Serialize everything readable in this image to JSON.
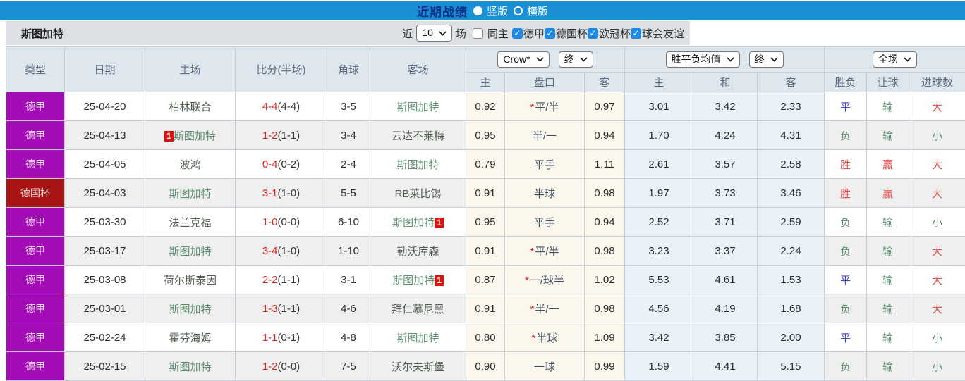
{
  "titlebar": {
    "title": "近期战绩",
    "options": [
      {
        "label": "竖版",
        "selected": true
      },
      {
        "label": "横版",
        "selected": false
      }
    ]
  },
  "toolbar": {
    "team": "斯图加特",
    "recent_label": "近",
    "recent_count": "10",
    "unit_label": "场",
    "same_home": {
      "label": "同主",
      "checked": false
    },
    "league_filters": [
      {
        "label": "德甲",
        "checked": true
      },
      {
        "label": "德国杯",
        "checked": true
      },
      {
        "label": "欧冠杯",
        "checked": true
      },
      {
        "label": "球会友谊",
        "checked": true
      }
    ]
  },
  "table": {
    "main_headers": [
      "类型",
      "日期",
      "主场",
      "比分(半场)",
      "角球",
      "客场"
    ],
    "selects": {
      "bookmaker": "Crow*",
      "bookmaker_period": "终",
      "avg": "胜平负均值",
      "avg_period": "终",
      "scope": "全场"
    },
    "sub_headers": [
      "主",
      "盘口",
      "客",
      "主",
      "和",
      "客",
      "胜负",
      "让球",
      "进球数"
    ],
    "rows": [
      {
        "type": "德甲",
        "type_cls": "purple",
        "date": "25-04-20",
        "home": {
          "name": "柏林联合",
          "hl": false,
          "badge": null,
          "badge_pos": null
        },
        "score": {
          "full": "4-4",
          "half": "(4-4)"
        },
        "corners": "3-5",
        "away": {
          "name": "斯图加特",
          "hl": true,
          "badge": null,
          "badge_pos": null
        },
        "odds": {
          "home": "0.92",
          "star": true,
          "handicap": "平/半",
          "away": "0.97"
        },
        "avg": [
          "3.01",
          "3.42",
          "2.33"
        ],
        "result": [
          {
            "t": "平",
            "c": "blue"
          },
          {
            "t": "输",
            "c": "green"
          },
          {
            "t": "大",
            "c": "red"
          }
        ]
      },
      {
        "type": "德甲",
        "type_cls": "purple",
        "date": "25-04-13",
        "home": {
          "name": "斯图加特",
          "hl": true,
          "badge": "1",
          "badge_pos": "before"
        },
        "score": {
          "full": "1-2",
          "half": "(1-1)"
        },
        "corners": "3-4",
        "away": {
          "name": "云达不莱梅",
          "hl": false,
          "badge": null,
          "badge_pos": null
        },
        "odds": {
          "home": "0.95",
          "star": false,
          "handicap": "半/一",
          "away": "0.94"
        },
        "avg": [
          "1.70",
          "4.24",
          "4.31"
        ],
        "result": [
          {
            "t": "负",
            "c": "green"
          },
          {
            "t": "输",
            "c": "green"
          },
          {
            "t": "小",
            "c": "green"
          }
        ]
      },
      {
        "type": "德甲",
        "type_cls": "purple",
        "date": "25-04-05",
        "home": {
          "name": "波鸿",
          "hl": false,
          "badge": null,
          "badge_pos": null
        },
        "score": {
          "full": "0-4",
          "half": "(0-2)"
        },
        "corners": "2-4",
        "away": {
          "name": "斯图加特",
          "hl": true,
          "badge": null,
          "badge_pos": null
        },
        "odds": {
          "home": "0.79",
          "star": false,
          "handicap": "平手",
          "away": "1.11"
        },
        "avg": [
          "2.61",
          "3.57",
          "2.58"
        ],
        "result": [
          {
            "t": "胜",
            "c": "red"
          },
          {
            "t": "赢",
            "c": "red"
          },
          {
            "t": "大",
            "c": "red"
          }
        ]
      },
      {
        "type": "德国杯",
        "type_cls": "red",
        "date": "25-04-03",
        "home": {
          "name": "斯图加特",
          "hl": true,
          "badge": null,
          "badge_pos": null
        },
        "score": {
          "full": "3-1",
          "half": "(1-0)"
        },
        "corners": "5-5",
        "away": {
          "name": "RB莱比锡",
          "hl": false,
          "badge": null,
          "badge_pos": null
        },
        "odds": {
          "home": "0.91",
          "star": false,
          "handicap": "半球",
          "away": "0.98"
        },
        "avg": [
          "1.97",
          "3.73",
          "3.46"
        ],
        "result": [
          {
            "t": "胜",
            "c": "red"
          },
          {
            "t": "赢",
            "c": "red"
          },
          {
            "t": "大",
            "c": "red"
          }
        ]
      },
      {
        "type": "德甲",
        "type_cls": "purple",
        "date": "25-03-30",
        "home": {
          "name": "法兰克福",
          "hl": false,
          "badge": null,
          "badge_pos": null
        },
        "score": {
          "full": "1-0",
          "half": "(0-0)"
        },
        "corners": "6-10",
        "away": {
          "name": "斯图加特",
          "hl": true,
          "badge": "1",
          "badge_pos": "after"
        },
        "odds": {
          "home": "0.95",
          "star": false,
          "handicap": "平手",
          "away": "0.94"
        },
        "avg": [
          "2.52",
          "3.71",
          "2.59"
        ],
        "result": [
          {
            "t": "负",
            "c": "green"
          },
          {
            "t": "输",
            "c": "green"
          },
          {
            "t": "小",
            "c": "green"
          }
        ]
      },
      {
        "type": "德甲",
        "type_cls": "purple",
        "date": "25-03-17",
        "home": {
          "name": "斯图加特",
          "hl": true,
          "badge": null,
          "badge_pos": null
        },
        "score": {
          "full": "3-4",
          "half": "(1-0)"
        },
        "corners": "1-10",
        "away": {
          "name": "勒沃库森",
          "hl": false,
          "badge": null,
          "badge_pos": null
        },
        "odds": {
          "home": "0.91",
          "star": true,
          "handicap": "平/半",
          "away": "0.98"
        },
        "avg": [
          "3.23",
          "3.37",
          "2.24"
        ],
        "result": [
          {
            "t": "负",
            "c": "green"
          },
          {
            "t": "输",
            "c": "green"
          },
          {
            "t": "大",
            "c": "red"
          }
        ]
      },
      {
        "type": "德甲",
        "type_cls": "purple",
        "date": "25-03-08",
        "home": {
          "name": "荷尔斯泰因",
          "hl": false,
          "badge": null,
          "badge_pos": null
        },
        "score": {
          "full": "2-2",
          "half": "(1-1)"
        },
        "corners": "3-1",
        "away": {
          "name": "斯图加特",
          "hl": true,
          "badge": "1",
          "badge_pos": "after"
        },
        "odds": {
          "home": "0.87",
          "star": true,
          "handicap": "一/球半",
          "away": "1.02"
        },
        "avg": [
          "5.53",
          "4.61",
          "1.53"
        ],
        "result": [
          {
            "t": "平",
            "c": "blue"
          },
          {
            "t": "输",
            "c": "green"
          },
          {
            "t": "大",
            "c": "red"
          }
        ]
      },
      {
        "type": "德甲",
        "type_cls": "purple",
        "date": "25-03-01",
        "home": {
          "name": "斯图加特",
          "hl": true,
          "badge": null,
          "badge_pos": null
        },
        "score": {
          "full": "1-3",
          "half": "(1-1)"
        },
        "corners": "4-6",
        "away": {
          "name": "拜仁慕尼黑",
          "hl": false,
          "badge": null,
          "badge_pos": null
        },
        "odds": {
          "home": "0.91",
          "star": true,
          "handicap": "半/一",
          "away": "0.98"
        },
        "avg": [
          "4.56",
          "4.19",
          "1.68"
        ],
        "result": [
          {
            "t": "负",
            "c": "green"
          },
          {
            "t": "输",
            "c": "green"
          },
          {
            "t": "大",
            "c": "red"
          }
        ]
      },
      {
        "type": "德甲",
        "type_cls": "purple",
        "date": "25-02-24",
        "home": {
          "name": "霍芬海姆",
          "hl": false,
          "badge": null,
          "badge_pos": null
        },
        "score": {
          "full": "1-1",
          "half": "(0-1)"
        },
        "corners": "4-8",
        "away": {
          "name": "斯图加特",
          "hl": true,
          "badge": null,
          "badge_pos": null
        },
        "odds": {
          "home": "0.80",
          "star": true,
          "handicap": "半球",
          "away": "1.09"
        },
        "avg": [
          "3.42",
          "3.85",
          "2.00"
        ],
        "result": [
          {
            "t": "平",
            "c": "blue"
          },
          {
            "t": "输",
            "c": "green"
          },
          {
            "t": "小",
            "c": "green"
          }
        ]
      },
      {
        "type": "德甲",
        "type_cls": "purple",
        "date": "25-02-15",
        "home": {
          "name": "斯图加特",
          "hl": true,
          "badge": null,
          "badge_pos": null
        },
        "score": {
          "full": "1-2",
          "half": "(0-0)"
        },
        "corners": "7-5",
        "away": {
          "name": "沃尔夫斯堡",
          "hl": false,
          "badge": null,
          "badge_pos": null
        },
        "odds": {
          "home": "0.90",
          "star": false,
          "handicap": "一球",
          "away": "0.99"
        },
        "avg": [
          "1.59",
          "4.41",
          "5.15"
        ],
        "result": [
          {
            "t": "负",
            "c": "green"
          },
          {
            "t": "输",
            "c": "green"
          },
          {
            "t": "小",
            "c": "green"
          }
        ]
      }
    ]
  },
  "colors": {
    "accent_blue": "#1b8fd6",
    "league_purple": "#a10cb4",
    "cup_red": "#a81414",
    "team_green": "#5f8f6f",
    "score_red": "#e02020",
    "result_red": "#e04e4e",
    "result_green": "#5f8f6f",
    "result_blue": "#4848d8",
    "checkbox_blue": "#1e88e5"
  }
}
